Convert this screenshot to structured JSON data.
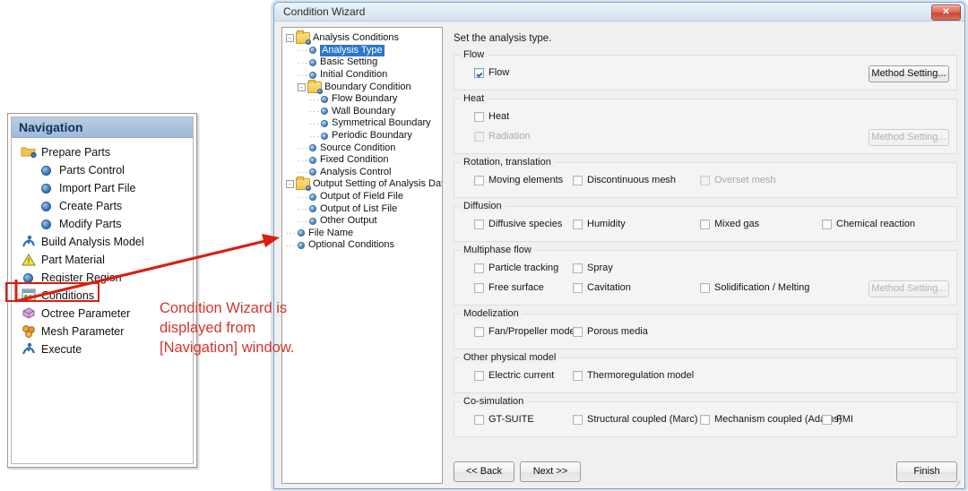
{
  "navigation": {
    "title": "Navigation",
    "items": [
      {
        "label": "Prepare Parts",
        "icon": "folder-icon",
        "level": 0
      },
      {
        "label": "Parts Control",
        "icon": "bullet-icon",
        "level": 1
      },
      {
        "label": "Import Part File",
        "icon": "bullet-icon",
        "level": 1
      },
      {
        "label": "Create Parts",
        "icon": "bullet-icon",
        "level": 1
      },
      {
        "label": "Modify Parts",
        "icon": "bullet-icon",
        "level": 1
      },
      {
        "label": "Build Analysis Model",
        "icon": "runner-icon",
        "level": 0
      },
      {
        "label": "Part Material",
        "icon": "warning-icon",
        "level": 0
      },
      {
        "label": "Register Region",
        "icon": "bullet-icon",
        "level": 0
      },
      {
        "label": "Conditions",
        "icon": "conditions-icon",
        "level": 0
      },
      {
        "label": "Octree Parameter",
        "icon": "octree-icon",
        "level": 0
      },
      {
        "label": "Mesh Parameter",
        "icon": "mesh-icon",
        "level": 0
      },
      {
        "label": "Execute",
        "icon": "runner-icon",
        "level": 0
      }
    ],
    "highlighted_item": "Conditions"
  },
  "annotation": {
    "lines": [
      "Condition Wizard is",
      "displayed from",
      "[Navigation] window."
    ],
    "color": "#d6342a"
  },
  "dialog": {
    "title": "Condition Wizard",
    "close_label": "✕",
    "instruction": "Set the analysis type.",
    "tree": [
      {
        "label": "Analysis Conditions",
        "level": 0,
        "icon": "folder-icon",
        "expander": "-",
        "selected": false
      },
      {
        "label": "Analysis Type",
        "level": 1,
        "icon": "bullet-icon",
        "expander": "",
        "selected": true
      },
      {
        "label": "Basic Setting",
        "level": 1,
        "icon": "bullet-icon",
        "expander": "",
        "selected": false
      },
      {
        "label": "Initial Condition",
        "level": 1,
        "icon": "bullet-icon",
        "expander": "",
        "selected": false
      },
      {
        "label": "Boundary Condition",
        "level": 1,
        "icon": "folder-icon",
        "expander": "-",
        "selected": false
      },
      {
        "label": "Flow Boundary",
        "level": 2,
        "icon": "bullet-icon",
        "expander": "",
        "selected": false
      },
      {
        "label": "Wall Boundary",
        "level": 2,
        "icon": "bullet-icon",
        "expander": "",
        "selected": false
      },
      {
        "label": "Symmetrical Boundary",
        "level": 2,
        "icon": "bullet-icon",
        "expander": "",
        "selected": false
      },
      {
        "label": "Periodic Boundary",
        "level": 2,
        "icon": "bullet-icon",
        "expander": "",
        "selected": false
      },
      {
        "label": "Source Condition",
        "level": 1,
        "icon": "bullet-icon",
        "expander": "",
        "selected": false
      },
      {
        "label": "Fixed Condition",
        "level": 1,
        "icon": "bullet-icon",
        "expander": "",
        "selected": false
      },
      {
        "label": "Analysis Control",
        "level": 1,
        "icon": "bullet-icon",
        "expander": "",
        "selected": false
      },
      {
        "label": "Output Setting of Analysis Data",
        "level": 0,
        "icon": "folder-icon",
        "expander": "-",
        "selected": false
      },
      {
        "label": "Output of Field File",
        "level": 1,
        "icon": "bullet-icon",
        "expander": "",
        "selected": false
      },
      {
        "label": "Output of List File",
        "level": 1,
        "icon": "bullet-icon",
        "expander": "",
        "selected": false
      },
      {
        "label": "Other Output",
        "level": 1,
        "icon": "bullet-icon",
        "expander": "",
        "selected": false
      },
      {
        "label": "File Name",
        "level": 0,
        "icon": "bullet-icon",
        "expander": "",
        "selected": false
      },
      {
        "label": "Optional Conditions",
        "level": 0,
        "icon": "bullet-icon",
        "expander": "",
        "selected": false
      }
    ],
    "groups": [
      {
        "title": "Flow",
        "rows": [
          {
            "items": [
              {
                "label": "Flow",
                "checked": true,
                "enabled": true,
                "indent": 0
              }
            ],
            "button": {
              "label": "Method Setting...",
              "enabled": true
            }
          }
        ]
      },
      {
        "title": "Heat",
        "rows": [
          {
            "items": [
              {
                "label": "Heat",
                "checked": false,
                "enabled": true,
                "indent": 0
              }
            ],
            "button": null
          },
          {
            "items": [
              {
                "label": "Radiation",
                "checked": false,
                "enabled": false,
                "indent": 0
              }
            ],
            "button": {
              "label": "Method Setting...",
              "enabled": false
            }
          }
        ]
      },
      {
        "title": "Rotation, translation",
        "rows": [
          {
            "items": [
              {
                "label": "Moving elements",
                "checked": false,
                "enabled": true,
                "indent": 0
              },
              {
                "label": "Discontinuous mesh",
                "checked": false,
                "enabled": true,
                "indent": 1
              },
              {
                "label": "Overset mesh",
                "checked": false,
                "enabled": false,
                "indent": 2
              }
            ],
            "button": null
          }
        ]
      },
      {
        "title": "Diffusion",
        "rows": [
          {
            "items": [
              {
                "label": "Diffusive species",
                "checked": false,
                "enabled": true,
                "indent": 0
              },
              {
                "label": "Humidity",
                "checked": false,
                "enabled": true,
                "indent": 1
              },
              {
                "label": "Mixed gas",
                "checked": false,
                "enabled": true,
                "indent": 2
              },
              {
                "label": "Chemical reaction",
                "checked": false,
                "enabled": true,
                "indent": 3
              }
            ],
            "button": null
          }
        ]
      },
      {
        "title": "Multiphase flow",
        "rows": [
          {
            "items": [
              {
                "label": "Particle tracking",
                "checked": false,
                "enabled": true,
                "indent": 0
              },
              {
                "label": "Spray",
                "checked": false,
                "enabled": true,
                "indent": 1
              }
            ],
            "button": null
          },
          {
            "items": [
              {
                "label": "Free surface",
                "checked": false,
                "enabled": true,
                "indent": 0
              },
              {
                "label": "Cavitation",
                "checked": false,
                "enabled": true,
                "indent": 1
              },
              {
                "label": "Solidification / Melting",
                "checked": false,
                "enabled": true,
                "indent": 2
              }
            ],
            "button": {
              "label": "Method Setting...",
              "enabled": false
            }
          }
        ]
      },
      {
        "title": "Modelization",
        "rows": [
          {
            "items": [
              {
                "label": "Fan/Propeller model",
                "checked": false,
                "enabled": true,
                "indent": 0
              },
              {
                "label": "Porous media",
                "checked": false,
                "enabled": true,
                "indent": 1
              }
            ],
            "button": null
          }
        ]
      },
      {
        "title": "Other physical model",
        "rows": [
          {
            "items": [
              {
                "label": "Electric current",
                "checked": false,
                "enabled": true,
                "indent": 0
              },
              {
                "label": "Thermoregulation model",
                "checked": false,
                "enabled": true,
                "indent": 1
              }
            ],
            "button": null
          }
        ]
      },
      {
        "title": "Co-simulation",
        "rows": [
          {
            "items": [
              {
                "label": "GT-SUITE",
                "checked": false,
                "enabled": true,
                "indent": 0
              },
              {
                "label": "Structural coupled (Marc)",
                "checked": false,
                "enabled": true,
                "indent": 1
              },
              {
                "label": "Mechanism coupled (Adams)",
                "checked": false,
                "enabled": true,
                "indent": 2
              },
              {
                "label": "FMI",
                "checked": false,
                "enabled": true,
                "indent": 3
              }
            ],
            "button": null
          }
        ]
      }
    ],
    "footer": {
      "back_label": "<< Back",
      "next_label": "Next >>",
      "finish_label": "Finish"
    }
  }
}
